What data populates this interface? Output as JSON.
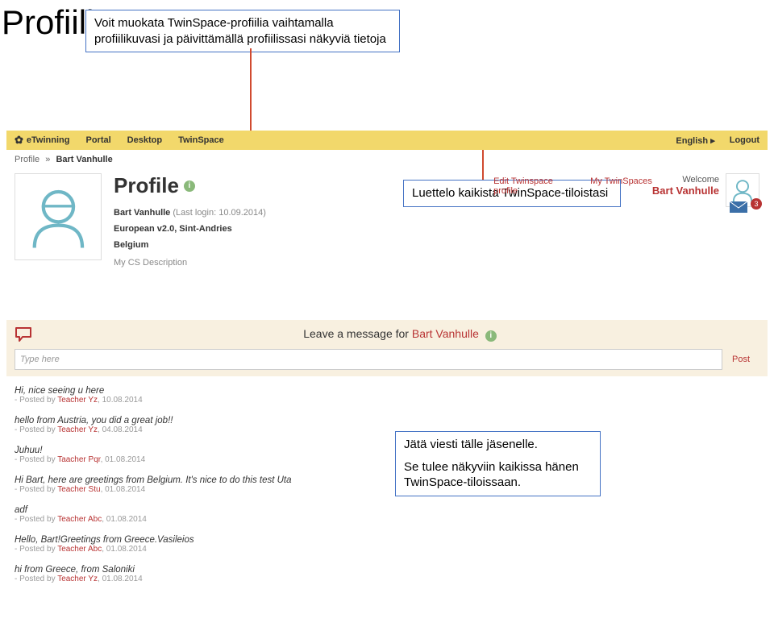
{
  "page_title": "Profiili",
  "annotations": {
    "a1": "Voit muokata TwinSpace-profiilia vaihtamalla profiilikuvasi ja päivittämällä profiilissasi näkyviä tietoja",
    "a2": "Luettelo kaikista TwinSpace-tiloistasi",
    "a3a": "Jätä viesti tälle jäsenelle.",
    "a3b": "Se tulee näkyviin kaikissa hänen TwinSpace-tiloissaan."
  },
  "topbar": {
    "brand": "eTwinning",
    "nav": [
      "Portal",
      "Desktop",
      "TwinSpace"
    ],
    "lang": "English",
    "logout": "Logout"
  },
  "breadcrumb": {
    "a": "Profile",
    "sep": "»",
    "b": "Bart Vanhulle"
  },
  "profile": {
    "heading": "Profile",
    "name": "Bart Vanhulle",
    "login_label": "(Last login: 10.09.2014)",
    "line2": "European v2.0, Sint-Andries",
    "line3": "Belgium",
    "desc": "My CS Description",
    "link_edit": "Edit Twinspace profile",
    "link_my": "My TwinSpaces"
  },
  "welcome": {
    "label": "Welcome",
    "name": "Bart Vanhulle",
    "badge": "3"
  },
  "message_box": {
    "prompt_a": "Leave a message for ",
    "prompt_b": "Bart Vanhulle",
    "placeholder": "Type here",
    "post": "Post"
  },
  "messages": [
    {
      "text": "Hi, nice seeing u here",
      "by": "Teacher Yz",
      "date": "10.08.2014"
    },
    {
      "text": "hello from Austria, you did a great job!!",
      "by": "Teacher Yz",
      "date": "04.08.2014"
    },
    {
      "text": "Juhuu!",
      "by": "Taacher Pqr",
      "date": "01.08.2014"
    },
    {
      "text": "Hi Bart, here are greetings from Belgium. It's nice to do this test Uta",
      "by": "Teacher Stu",
      "date": "01.08.2014"
    },
    {
      "text": "adf",
      "by": "Teacher Abc",
      "date": "01.08.2014"
    },
    {
      "text": "Hello, Bart!Greetings from Greece.Vasileios",
      "by": "Teacher Abc",
      "date": "01.08.2014"
    },
    {
      "text": "hi from Greece, from Saloniki",
      "by": "Teacher Yz",
      "date": "01.08.2014"
    }
  ],
  "posted_prefix": "- Posted by "
}
